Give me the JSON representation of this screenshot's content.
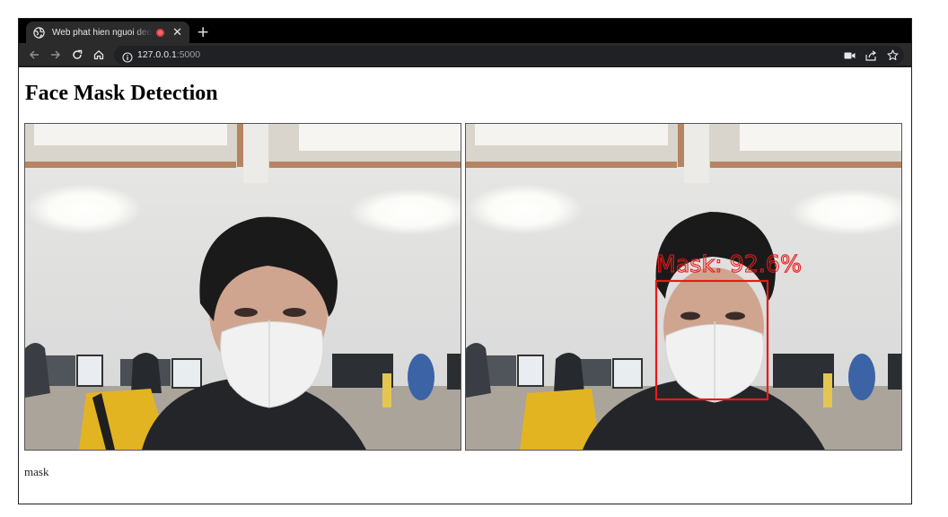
{
  "browser": {
    "tab_title": "Web phat hien nguoi deo khau trang",
    "url_host": "127.0.0.1",
    "url_port": ":5000"
  },
  "page": {
    "heading": "Face Mask Detection",
    "status": "mask"
  },
  "detection": {
    "label_text": "Mask: 92.6%",
    "label": "Mask",
    "confidence": 92.6,
    "box_color": "#e81a1a"
  },
  "colors": {
    "tab_strip": "#000000",
    "toolbar": "#2b2b2b",
    "omnibox": "#202124"
  },
  "icons": [
    "globe-icon",
    "recording-icon",
    "close-icon",
    "plus-icon",
    "back-icon",
    "forward-icon",
    "reload-icon",
    "home-icon",
    "info-icon",
    "camera-icon",
    "share-icon",
    "star-icon"
  ]
}
